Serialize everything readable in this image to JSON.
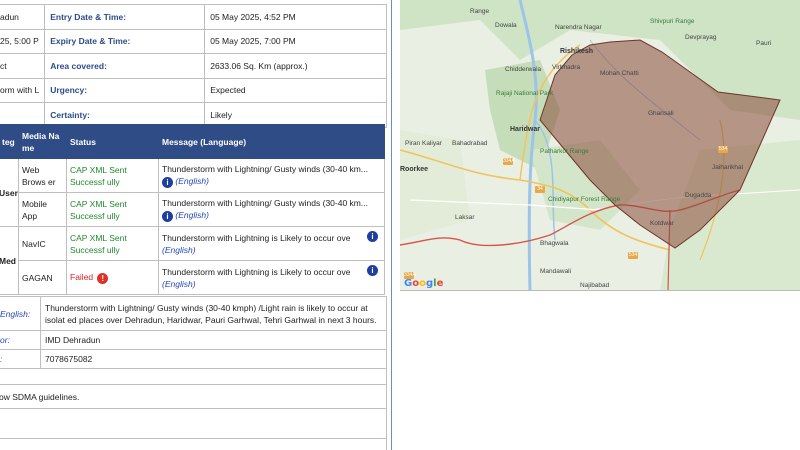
{
  "info": {
    "row1": {
      "col1": "adun",
      "key": "Entry Date & Time:",
      "value": "05 May 2025, 4:52 PM"
    },
    "row2": {
      "col1": "25, 5:00 P",
      "key": "Expiry Date & Time:",
      "value": "05 May 2025, 7:00 PM"
    },
    "row3": {
      "col1": "ct",
      "key": "Area covered:",
      "value": "2633.06 Sq. Km (approx.)"
    },
    "row4": {
      "col1": "orm with L",
      "key": "Urgency:",
      "value": "Expected"
    },
    "row5": {
      "col1": "",
      "key": "Certainty:",
      "value": "Likely"
    }
  },
  "dissemination": {
    "headers": {
      "cat": "teg",
      "media": "Media Na me",
      "status": "Status",
      "message": "Message (Language)"
    },
    "rows": [
      {
        "cat": "User",
        "media": "Web Brows er",
        "status": "CAP XML Sent Successf ully",
        "status_type": "ok",
        "message": "Thunderstorm with Lightning/ Gusty winds (30-40 km...",
        "lang": "(English)"
      },
      {
        "cat": "",
        "media": "Mobile App",
        "status": "CAP XML Sent Successf ully",
        "status_type": "ok",
        "message": "Thunderstorm with Lightning/ Gusty winds (30-40 km...",
        "lang": "(English)"
      },
      {
        "cat": "Med",
        "media": "NavIC",
        "status": "CAP XML Sent Successf ully",
        "status_type": "ok",
        "message": "Thunderstorm with Lightning is Likely to occur ove...",
        "lang": "(English)"
      },
      {
        "cat": "",
        "media": "GAGAN",
        "status": "Failed",
        "status_type": "fail",
        "message": "Thunderstorm with Lightning is Likely to occur ove...",
        "lang": "(English)"
      }
    ]
  },
  "details": {
    "english_key": "English:",
    "english_value": "Thunderstorm with Lightning/ Gusty winds (30-40 kmph) /Light rain is likely to occur at isolat ed places over Dehradun, Haridwar, Pauri Garhwal, Tehri Garhwal in next 3 hours.",
    "sender_key": "or:",
    "sender_value": "IMD Dehradun",
    "contact_key": ":",
    "contact_value": "7078675082",
    "instruction_value": "ow SDMA guidelines."
  },
  "map": {
    "labels": {
      "range_top": "Range",
      "dowala": "Dowala",
      "narendra": "Narendra Nagar",
      "shivpuri": "Shivpuri Range",
      "rishikesh": "Rishikesh",
      "virbhadra": "Virbhadra",
      "mohan_chatti": "Mohan Chatti",
      "chidderwala": "Chidderwala",
      "rajaji": "Rajaji National Park",
      "haridwar": "Haridwar",
      "ghansali": "Ghansali",
      "pirankaliyar": "Piran Kaliyar",
      "bahadrabad": "Bahadrabad",
      "patharkot": "Patharkot Range",
      "roorkee": "Roorkee",
      "chidiyapur": "Chidiyapur Forest Range",
      "laksar": "Laksar",
      "bhagwala": "Bhagwala",
      "jaiharikhal": "Jaiharikhal",
      "dugadda": "Dugadda",
      "kotdwar": "Kotdwar",
      "mandawali": "Mandawali",
      "najibabad": "Najibabad",
      "devprayag": "Devprayag",
      "pauri": "Pauri"
    },
    "routes": [
      "334A",
      "34",
      "534",
      "334A",
      "534"
    ],
    "polygon_color": "#8b4a3a",
    "logo": "Google"
  }
}
